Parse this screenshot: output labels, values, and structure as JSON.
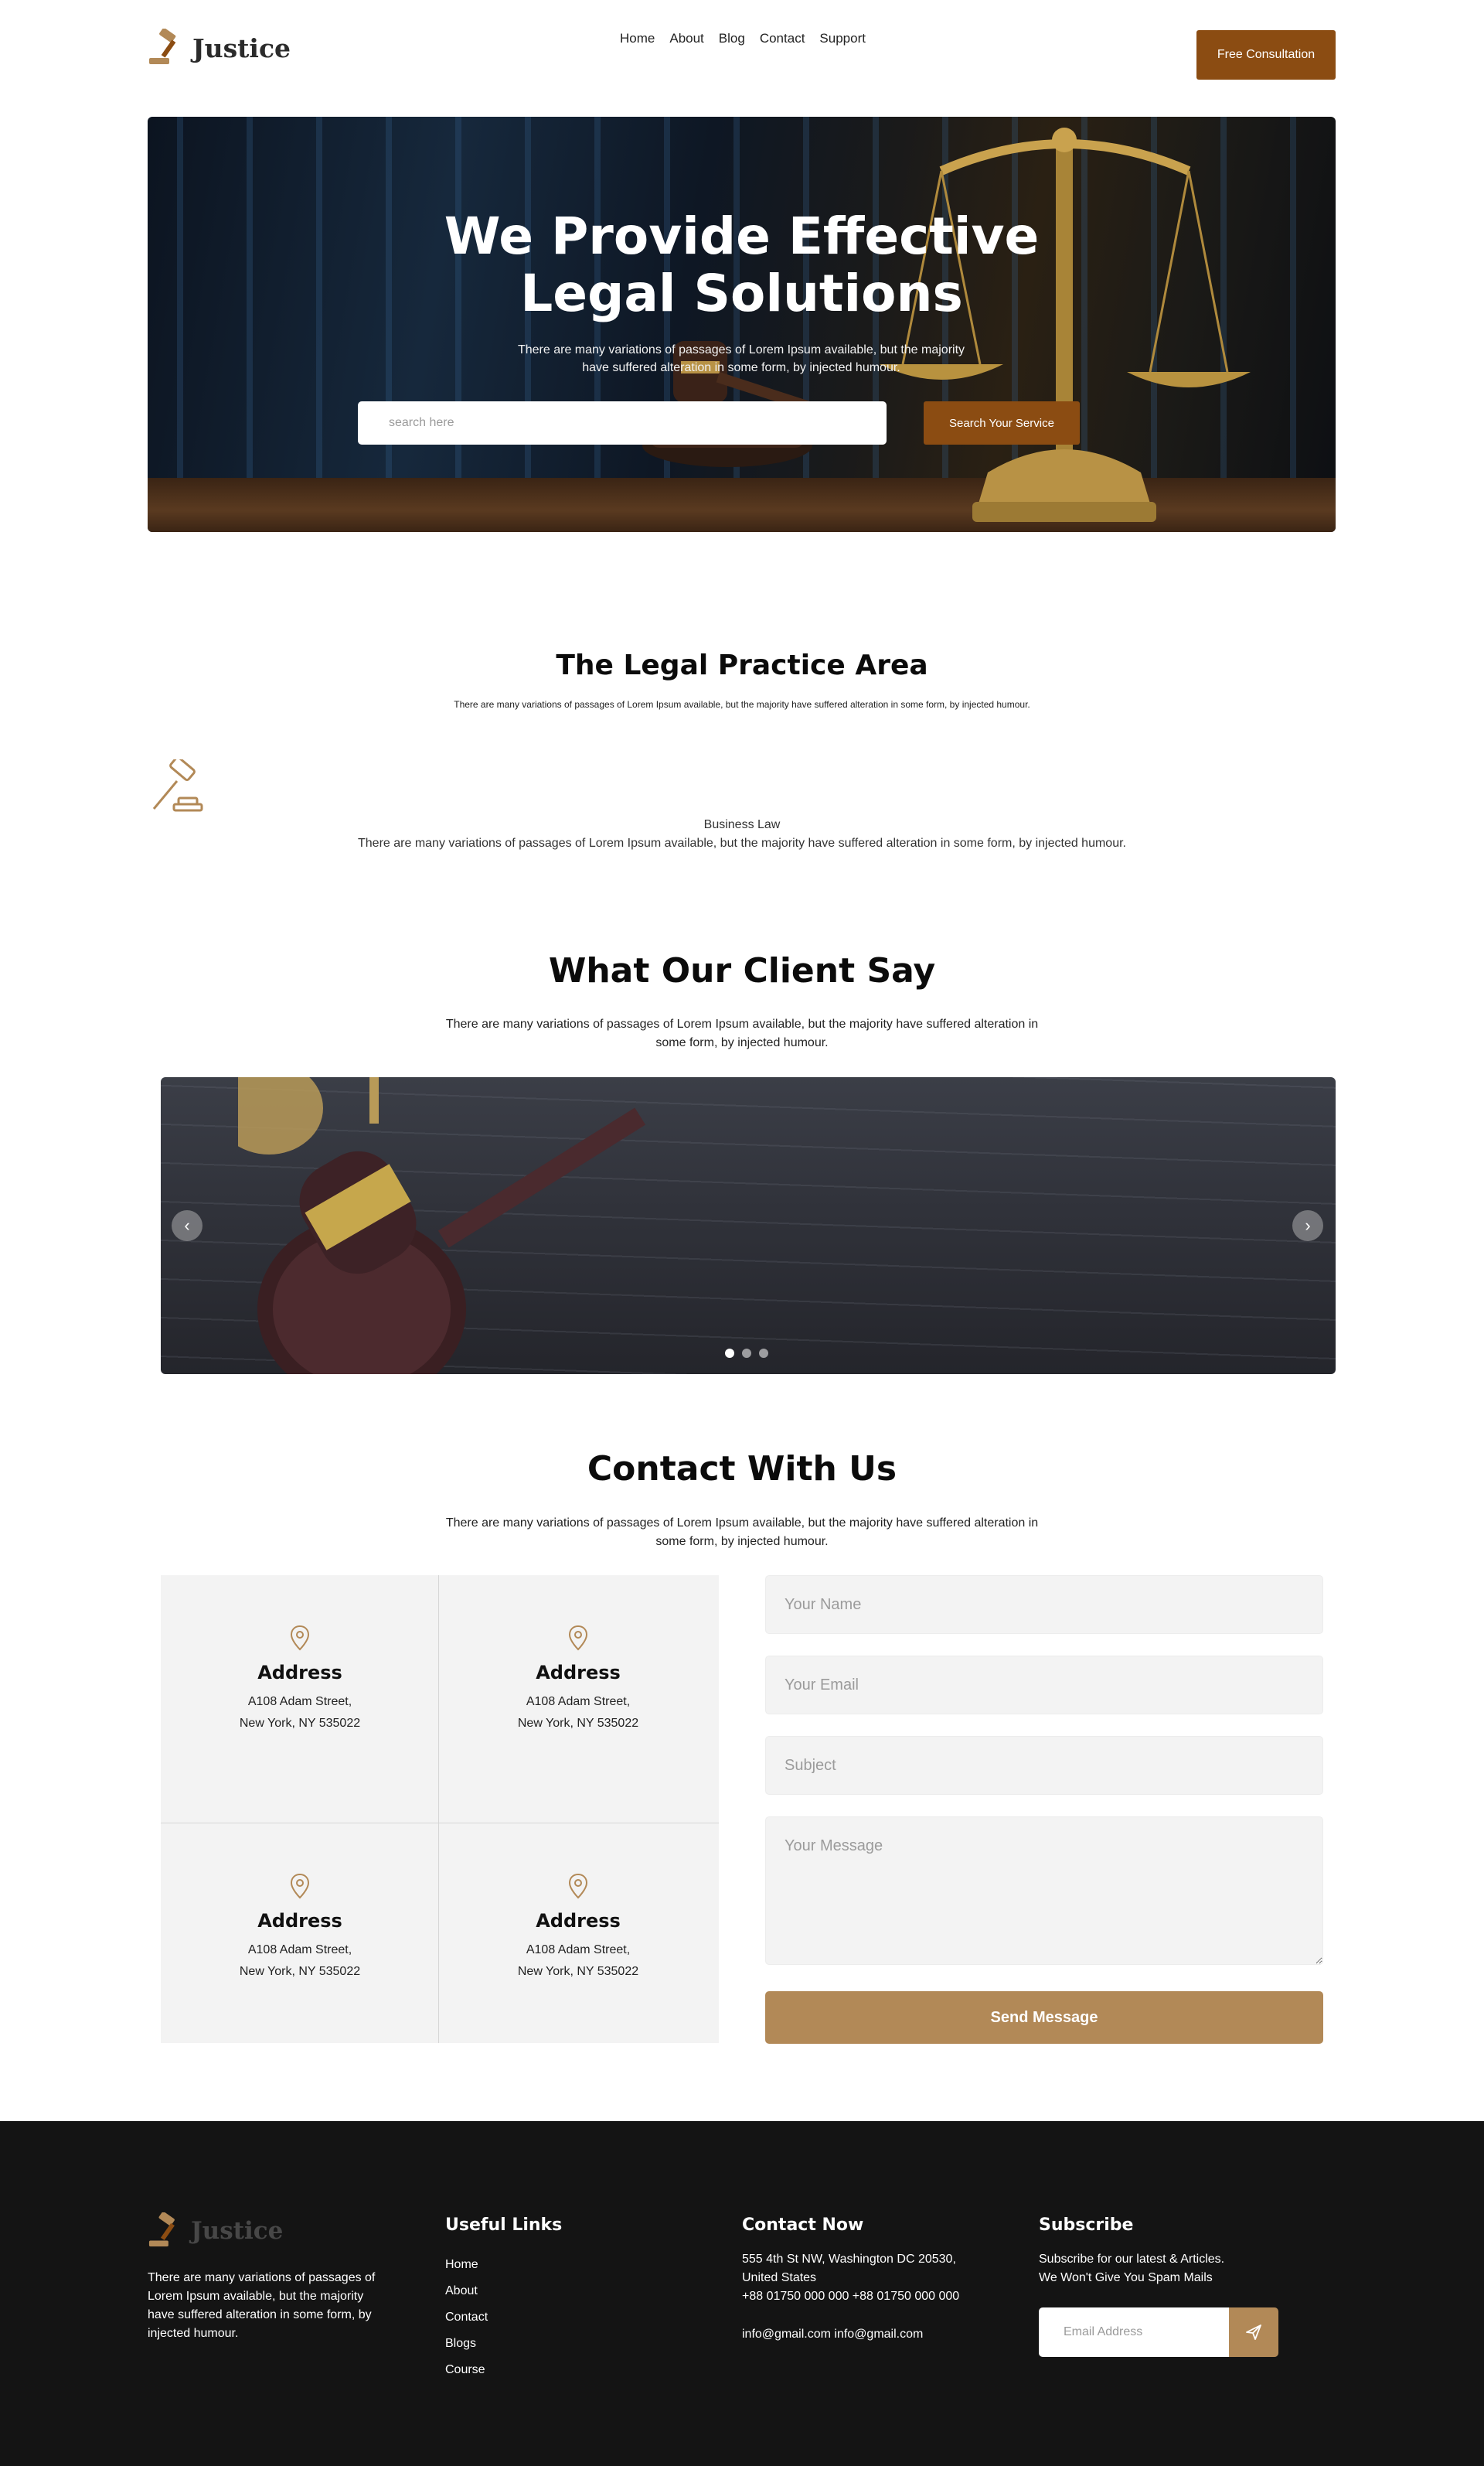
{
  "brand": {
    "name": "Justice",
    "accent": "#8b4c12",
    "gold": "#b28957"
  },
  "nav": {
    "links": [
      "Home",
      "About",
      "Blog",
      "Contact",
      "Support"
    ],
    "cta": "Free Consultation"
  },
  "hero": {
    "title_line1": "We Provide Effective",
    "title_line2": "Legal Solutions",
    "subtitle": "There are many variations of passages of Lorem Ipsum available, but the majority have suffered alteration in some form, by injected humour.",
    "search_placeholder": "search here",
    "search_button": "Search Your Service"
  },
  "practice": {
    "title": "The Legal Practice Area",
    "subtitle": "There are many variations of passages of Lorem Ipsum available, but the majority have suffered alteration in some form, by injected humour.",
    "item_name": "Business Law",
    "item_desc": "There are many variations of passages of Lorem Ipsum available, but the majority have suffered alteration in some form, by injected humour.",
    "icon": "gavel-icon"
  },
  "testimonials": {
    "title": "What Our Client Say",
    "subtitle": "There are many variations of passages of Lorem Ipsum available, but the majority have suffered alteration in some form, by injected humour.",
    "prev_icon": "‹",
    "next_icon": "›",
    "slide_count": 3,
    "active_slide": 1
  },
  "contact": {
    "title": "Contact With Us",
    "subtitle": "There are many variations of passages of Lorem Ipsum available, but the majority have suffered alteration in some form, by injected humour.",
    "cards": [
      {
        "title": "Address",
        "line1": "A108 Adam Street,",
        "line2": "New York, NY 535022"
      },
      {
        "title": "Address",
        "line1": "A108 Adam Street,",
        "line2": "New York, NY 535022"
      },
      {
        "title": "Address",
        "line1": "A108 Adam Street,",
        "line2": "New York, NY 535022"
      },
      {
        "title": "Address",
        "line1": "A108 Adam Street,",
        "line2": "New York, NY 535022"
      }
    ],
    "form": {
      "name_placeholder": "Your Name",
      "email_placeholder": "Your Email",
      "subject_placeholder": "Subject",
      "message_placeholder": "Your Message",
      "send_label": "Send Message"
    }
  },
  "footer": {
    "about": "There are many variations of passages of Lorem Ipsum available, but the majority have suffered alteration in some form, by injected humour.",
    "useful_links_title": "Useful Links",
    "useful_links": [
      "Home",
      "About",
      "Contact",
      "Blogs",
      "Course"
    ],
    "contact_title": "Contact Now",
    "contact_address": "555 4th St NW, Washington DC 20530, United States",
    "contact_phone": "+88 01750 000 000 +88 01750 000 000",
    "contact_email": "info@gmail.com info@gmail.com",
    "subscribe_title": "Subscribe",
    "subscribe_text_1": "Subscribe for our latest & Articles.",
    "subscribe_text_2": "We Won't Give You Spam Mails",
    "subscribe_placeholder": "Email Address"
  }
}
